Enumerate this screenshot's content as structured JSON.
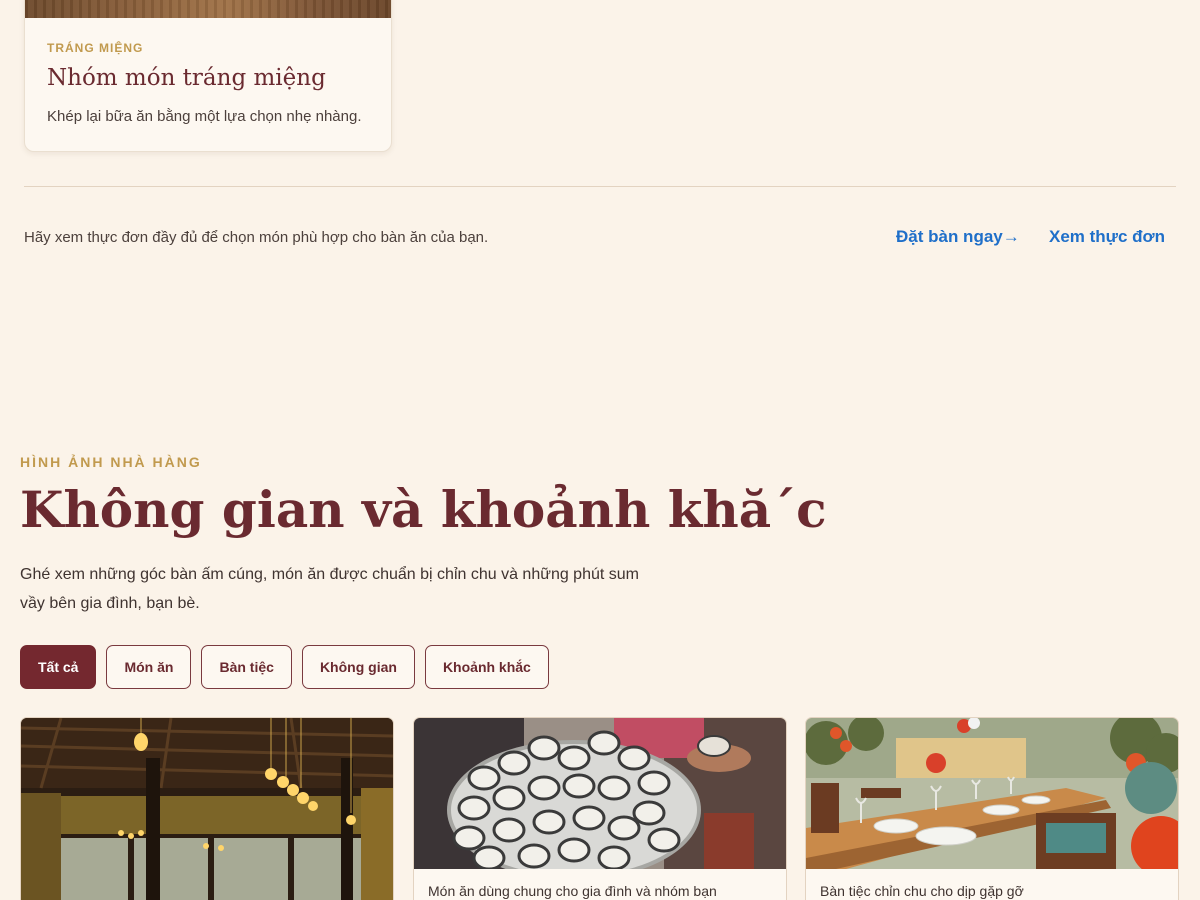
{
  "menu_card": {
    "eyebrow": "TRÁNG MIỆNG",
    "title": "Nhóm món tráng miệng",
    "description": "Khép lại bữa ăn bằng một lựa chọn nhẹ nhàng."
  },
  "cta": {
    "text": "Hãy xem thực đơn đầy đủ để chọn món phù hợp cho bàn ăn của bạn.",
    "book_label": "Đặt bàn ngay→",
    "menu_label": "Xem thực đơn"
  },
  "gallery": {
    "eyebrow": "HÌNH ẢNH NHÀ HÀNG",
    "title": "Không gian và khoảnh khă´c",
    "description": "Ghé xem những góc bàn ấm cúng, món ăn được chuẩn bị chỉn chu và những phút sum vầy bên gia đình, bạn bè.",
    "filters": [
      "Tất cả",
      "Món ăn",
      "Bàn tiệc",
      "Không gian",
      "Khoảnh khắc"
    ],
    "active_filter": "Tất cả",
    "cards": [
      {
        "caption": ""
      },
      {
        "caption": "Món ăn dùng chung cho gia đình và nhóm bạn"
      },
      {
        "caption": "Bàn tiệc chỉn chu cho dịp gặp gỡ"
      }
    ]
  },
  "colors": {
    "background": "#fbf3e9",
    "accent": "#74282f",
    "gold": "#c19a4e",
    "link": "#1f6fc9"
  }
}
